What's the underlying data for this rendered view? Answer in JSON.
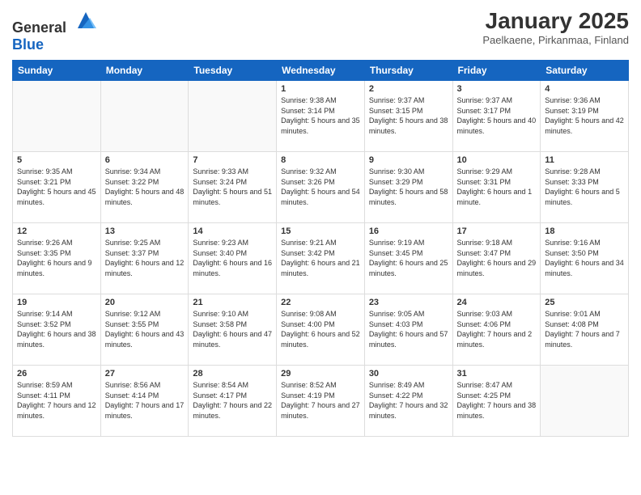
{
  "header": {
    "logo_general": "General",
    "logo_blue": "Blue",
    "title": "January 2025",
    "subtitle": "Paelkaene, Pirkanmaa, Finland"
  },
  "days_of_week": [
    "Sunday",
    "Monday",
    "Tuesday",
    "Wednesday",
    "Thursday",
    "Friday",
    "Saturday"
  ],
  "weeks": [
    [
      {
        "day": "",
        "info": ""
      },
      {
        "day": "",
        "info": ""
      },
      {
        "day": "",
        "info": ""
      },
      {
        "day": "1",
        "info": "Sunrise: 9:38 AM\nSunset: 3:14 PM\nDaylight: 5 hours and 35 minutes."
      },
      {
        "day": "2",
        "info": "Sunrise: 9:37 AM\nSunset: 3:15 PM\nDaylight: 5 hours and 38 minutes."
      },
      {
        "day": "3",
        "info": "Sunrise: 9:37 AM\nSunset: 3:17 PM\nDaylight: 5 hours and 40 minutes."
      },
      {
        "day": "4",
        "info": "Sunrise: 9:36 AM\nSunset: 3:19 PM\nDaylight: 5 hours and 42 minutes."
      }
    ],
    [
      {
        "day": "5",
        "info": "Sunrise: 9:35 AM\nSunset: 3:21 PM\nDaylight: 5 hours and 45 minutes."
      },
      {
        "day": "6",
        "info": "Sunrise: 9:34 AM\nSunset: 3:22 PM\nDaylight: 5 hours and 48 minutes."
      },
      {
        "day": "7",
        "info": "Sunrise: 9:33 AM\nSunset: 3:24 PM\nDaylight: 5 hours and 51 minutes."
      },
      {
        "day": "8",
        "info": "Sunrise: 9:32 AM\nSunset: 3:26 PM\nDaylight: 5 hours and 54 minutes."
      },
      {
        "day": "9",
        "info": "Sunrise: 9:30 AM\nSunset: 3:29 PM\nDaylight: 5 hours and 58 minutes."
      },
      {
        "day": "10",
        "info": "Sunrise: 9:29 AM\nSunset: 3:31 PM\nDaylight: 6 hours and 1 minute."
      },
      {
        "day": "11",
        "info": "Sunrise: 9:28 AM\nSunset: 3:33 PM\nDaylight: 6 hours and 5 minutes."
      }
    ],
    [
      {
        "day": "12",
        "info": "Sunrise: 9:26 AM\nSunset: 3:35 PM\nDaylight: 6 hours and 9 minutes."
      },
      {
        "day": "13",
        "info": "Sunrise: 9:25 AM\nSunset: 3:37 PM\nDaylight: 6 hours and 12 minutes."
      },
      {
        "day": "14",
        "info": "Sunrise: 9:23 AM\nSunset: 3:40 PM\nDaylight: 6 hours and 16 minutes."
      },
      {
        "day": "15",
        "info": "Sunrise: 9:21 AM\nSunset: 3:42 PM\nDaylight: 6 hours and 21 minutes."
      },
      {
        "day": "16",
        "info": "Sunrise: 9:19 AM\nSunset: 3:45 PM\nDaylight: 6 hours and 25 minutes."
      },
      {
        "day": "17",
        "info": "Sunrise: 9:18 AM\nSunset: 3:47 PM\nDaylight: 6 hours and 29 minutes."
      },
      {
        "day": "18",
        "info": "Sunrise: 9:16 AM\nSunset: 3:50 PM\nDaylight: 6 hours and 34 minutes."
      }
    ],
    [
      {
        "day": "19",
        "info": "Sunrise: 9:14 AM\nSunset: 3:52 PM\nDaylight: 6 hours and 38 minutes."
      },
      {
        "day": "20",
        "info": "Sunrise: 9:12 AM\nSunset: 3:55 PM\nDaylight: 6 hours and 43 minutes."
      },
      {
        "day": "21",
        "info": "Sunrise: 9:10 AM\nSunset: 3:58 PM\nDaylight: 6 hours and 47 minutes."
      },
      {
        "day": "22",
        "info": "Sunrise: 9:08 AM\nSunset: 4:00 PM\nDaylight: 6 hours and 52 minutes."
      },
      {
        "day": "23",
        "info": "Sunrise: 9:05 AM\nSunset: 4:03 PM\nDaylight: 6 hours and 57 minutes."
      },
      {
        "day": "24",
        "info": "Sunrise: 9:03 AM\nSunset: 4:06 PM\nDaylight: 7 hours and 2 minutes."
      },
      {
        "day": "25",
        "info": "Sunrise: 9:01 AM\nSunset: 4:08 PM\nDaylight: 7 hours and 7 minutes."
      }
    ],
    [
      {
        "day": "26",
        "info": "Sunrise: 8:59 AM\nSunset: 4:11 PM\nDaylight: 7 hours and 12 minutes."
      },
      {
        "day": "27",
        "info": "Sunrise: 8:56 AM\nSunset: 4:14 PM\nDaylight: 7 hours and 17 minutes."
      },
      {
        "day": "28",
        "info": "Sunrise: 8:54 AM\nSunset: 4:17 PM\nDaylight: 7 hours and 22 minutes."
      },
      {
        "day": "29",
        "info": "Sunrise: 8:52 AM\nSunset: 4:19 PM\nDaylight: 7 hours and 27 minutes."
      },
      {
        "day": "30",
        "info": "Sunrise: 8:49 AM\nSunset: 4:22 PM\nDaylight: 7 hours and 32 minutes."
      },
      {
        "day": "31",
        "info": "Sunrise: 8:47 AM\nSunset: 4:25 PM\nDaylight: 7 hours and 38 minutes."
      },
      {
        "day": "",
        "info": ""
      }
    ]
  ]
}
